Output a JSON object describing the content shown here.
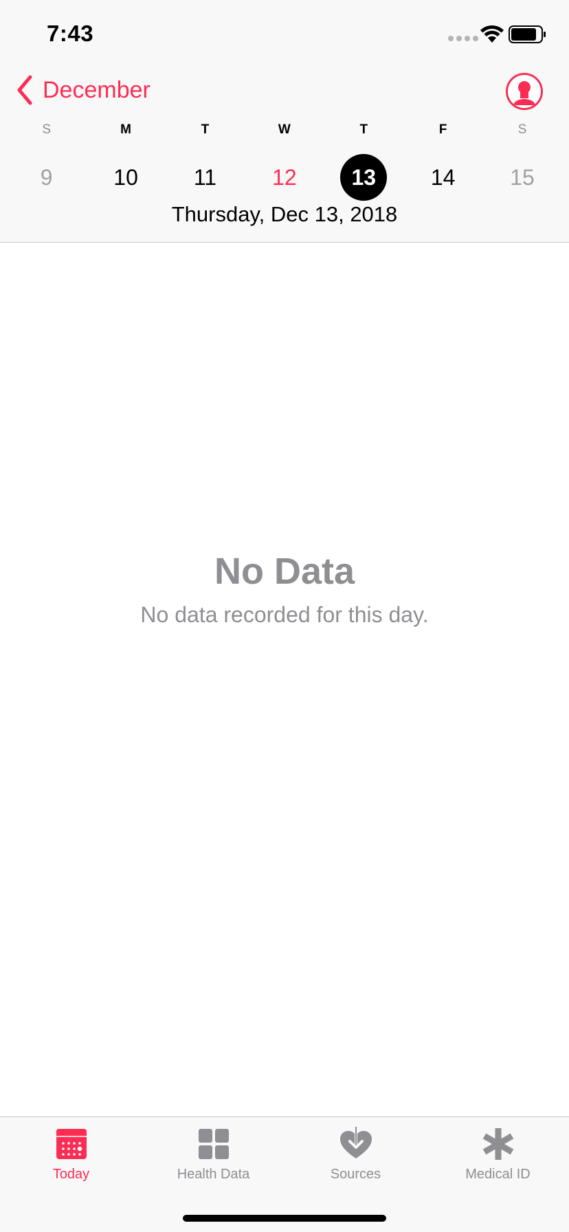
{
  "status_bar": {
    "time": "7:43"
  },
  "nav": {
    "back_label": "December",
    "back_icon": "chevron-left-icon",
    "profile_icon": "person-icon"
  },
  "calendar": {
    "weekdays": [
      "S",
      "M",
      "T",
      "W",
      "T",
      "F",
      "S"
    ],
    "days": [
      "9",
      "10",
      "11",
      "12",
      "13",
      "14",
      "15"
    ],
    "today_day": "12",
    "selected_day": "13",
    "selected_date_label": "Thursday, Dec 13, 2018"
  },
  "empty_state": {
    "title": "No Data",
    "subtitle": "No data recorded for this day."
  },
  "tabs": [
    {
      "label": "Today",
      "icon": "calendar-icon",
      "active": true
    },
    {
      "label": "Health Data",
      "icon": "grid-icon",
      "active": false
    },
    {
      "label": "Sources",
      "icon": "heart-arrow-icon",
      "active": false
    },
    {
      "label": "Medical ID",
      "icon": "asterisk-icon",
      "active": false
    }
  ],
  "colors": {
    "accent": "#fb2d55",
    "secondary_text": "#8e8e93",
    "bar_background": "#f8f8f8"
  }
}
